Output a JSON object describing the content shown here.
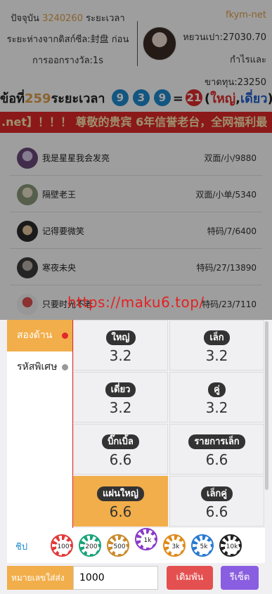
{
  "header": {
    "left_line1_prefix": "ปัจจุบัน",
    "left_line1_num": "3240260",
    "left_line1_suffix": "ระยะเวลา",
    "left_line2": "ระยะห่างจากดิสก์ซีล:封盘 ก่อน",
    "left_line3": "การออกรางวัล:1s",
    "brand": "fkym-net",
    "balance": "หยวนเปา:27030.70",
    "profit": "กำไรและ",
    "loss": "ขาดทุน:23250"
  },
  "period": {
    "prefix": "ข้อที่",
    "number": "259",
    "suffix": "ระยะเวลา",
    "balls": [
      "9",
      "3",
      "9"
    ],
    "equals": "=",
    "sum": "21",
    "open_paren": "(",
    "result_big": "ใหญ่",
    "comma": ",",
    "result_odd": "เดี่ยว",
    "close_paren": ")"
  },
  "marquee": ".net】！！！ 尊敬的贵宾 6年信誉老台，全网福利最",
  "bets": [
    {
      "name": "我是星星我会发亮",
      "bet": "双面/小/9880"
    },
    {
      "name": "隔壁老王",
      "bet": "双面/小单/5340"
    },
    {
      "name": "记得要微笑",
      "bet": "特码/7/6400"
    },
    {
      "name": "寒夜未央",
      "bet": "特码/27/13890"
    },
    {
      "name": "只要时光不老",
      "bet": "特码/23/7110"
    }
  ],
  "watermark": "https://maku6.top/",
  "tabs": [
    {
      "label": "สองด้าน",
      "dot_color": "#e02a2a"
    },
    {
      "label": "รหัสพิเศษ",
      "dot_color": "#999999"
    }
  ],
  "options": [
    {
      "label": "ใหญ่",
      "odds": "3.2"
    },
    {
      "label": "เล็ก",
      "odds": "3.2"
    },
    {
      "label": "เดี่ยว",
      "odds": "3.2"
    },
    {
      "label": "คู่",
      "odds": "3.2"
    },
    {
      "label": "บิ๊กเบิ้ล",
      "odds": "6.6"
    },
    {
      "label": "รายการเล็ก",
      "odds": "6.6"
    },
    {
      "label": "แผ่นใหญ่",
      "odds": "6.6"
    },
    {
      "label": "เล็กคู่",
      "odds": "6.6"
    }
  ],
  "chips": {
    "label": "ชิป",
    "values": [
      "100",
      "200",
      "500",
      "1k",
      "3k",
      "5k",
      "10k"
    ],
    "colors": [
      "#e23a3a",
      "#1aa37a",
      "#c98a2a",
      "#8a3cc8",
      "#e08a1a",
      "#2a7ad0",
      "#222222"
    ]
  },
  "bottom": {
    "placeholder_label": "หมายเลขใส่ส่ง",
    "amount": "1000",
    "submit_label": "เดิมพัน",
    "reset_label": "รีเซ็ต"
  },
  "colors": {
    "accent": "#f2ae4a",
    "submit": "#e45050",
    "reset": "#8a5ee0"
  }
}
